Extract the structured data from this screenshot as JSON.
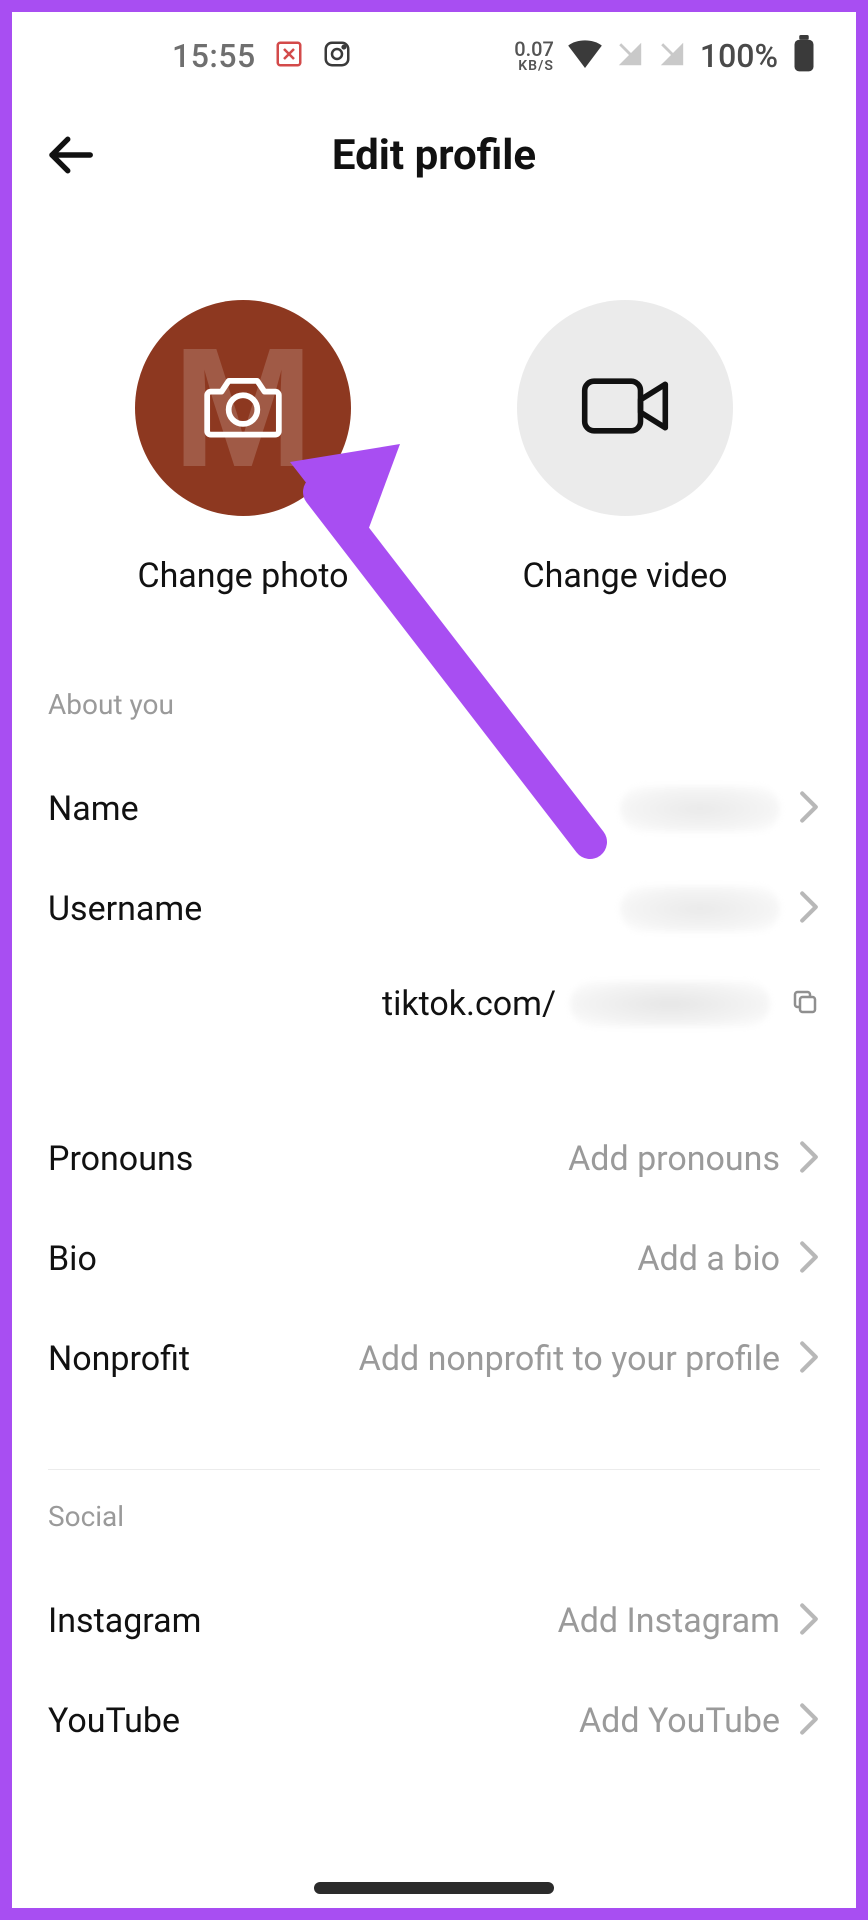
{
  "status": {
    "time": "15:55",
    "kbs_value": "0.07",
    "kbs_label": "KB/S",
    "battery_pct": "100%"
  },
  "header": {
    "title": "Edit profile"
  },
  "media": {
    "photo_label": "Change photo",
    "video_label": "Change video",
    "avatar_letter": "M"
  },
  "sections": {
    "about_header": "About you",
    "social_header": "Social"
  },
  "rows": {
    "name_label": "Name",
    "username_label": "Username",
    "tiktok_prefix": "tiktok.com/",
    "pronouns_label": "Pronouns",
    "pronouns_value": "Add pronouns",
    "bio_label": "Bio",
    "bio_value": "Add a bio",
    "nonprofit_label": "Nonprofit",
    "nonprofit_value": "Add nonprofit to your profile",
    "instagram_label": "Instagram",
    "instagram_value": "Add Instagram",
    "youtube_label": "YouTube",
    "youtube_value": "Add YouTube"
  }
}
